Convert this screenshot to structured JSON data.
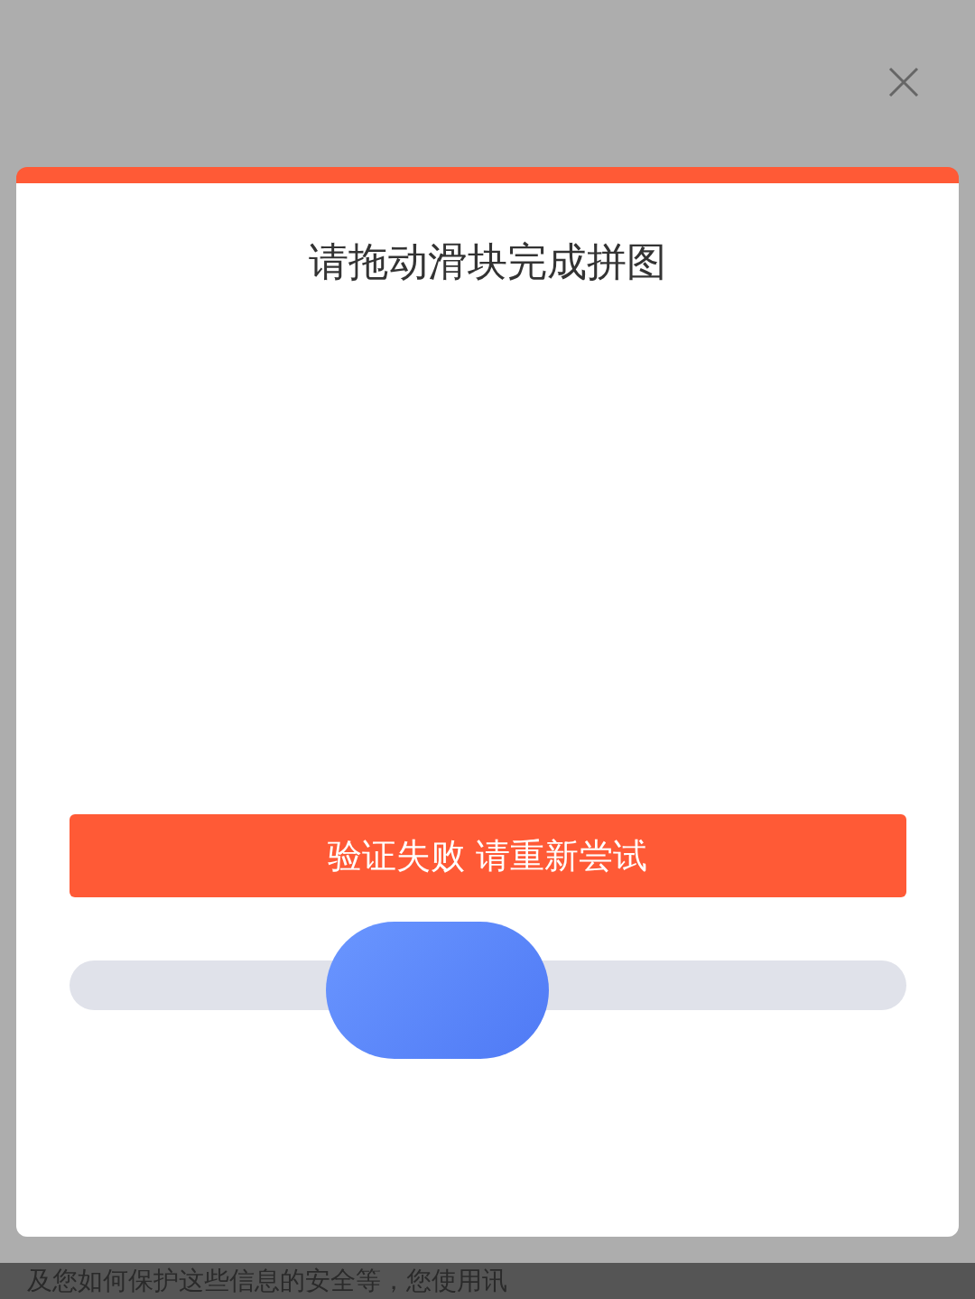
{
  "background": {
    "footer_text": "及您如何保护这些信息的安全等，您使用讯"
  },
  "dialog": {
    "title": "请拖动滑块完成拼图",
    "error_message": "验证失败 请重新尝试",
    "slider": {
      "level": 0.44
    }
  }
}
